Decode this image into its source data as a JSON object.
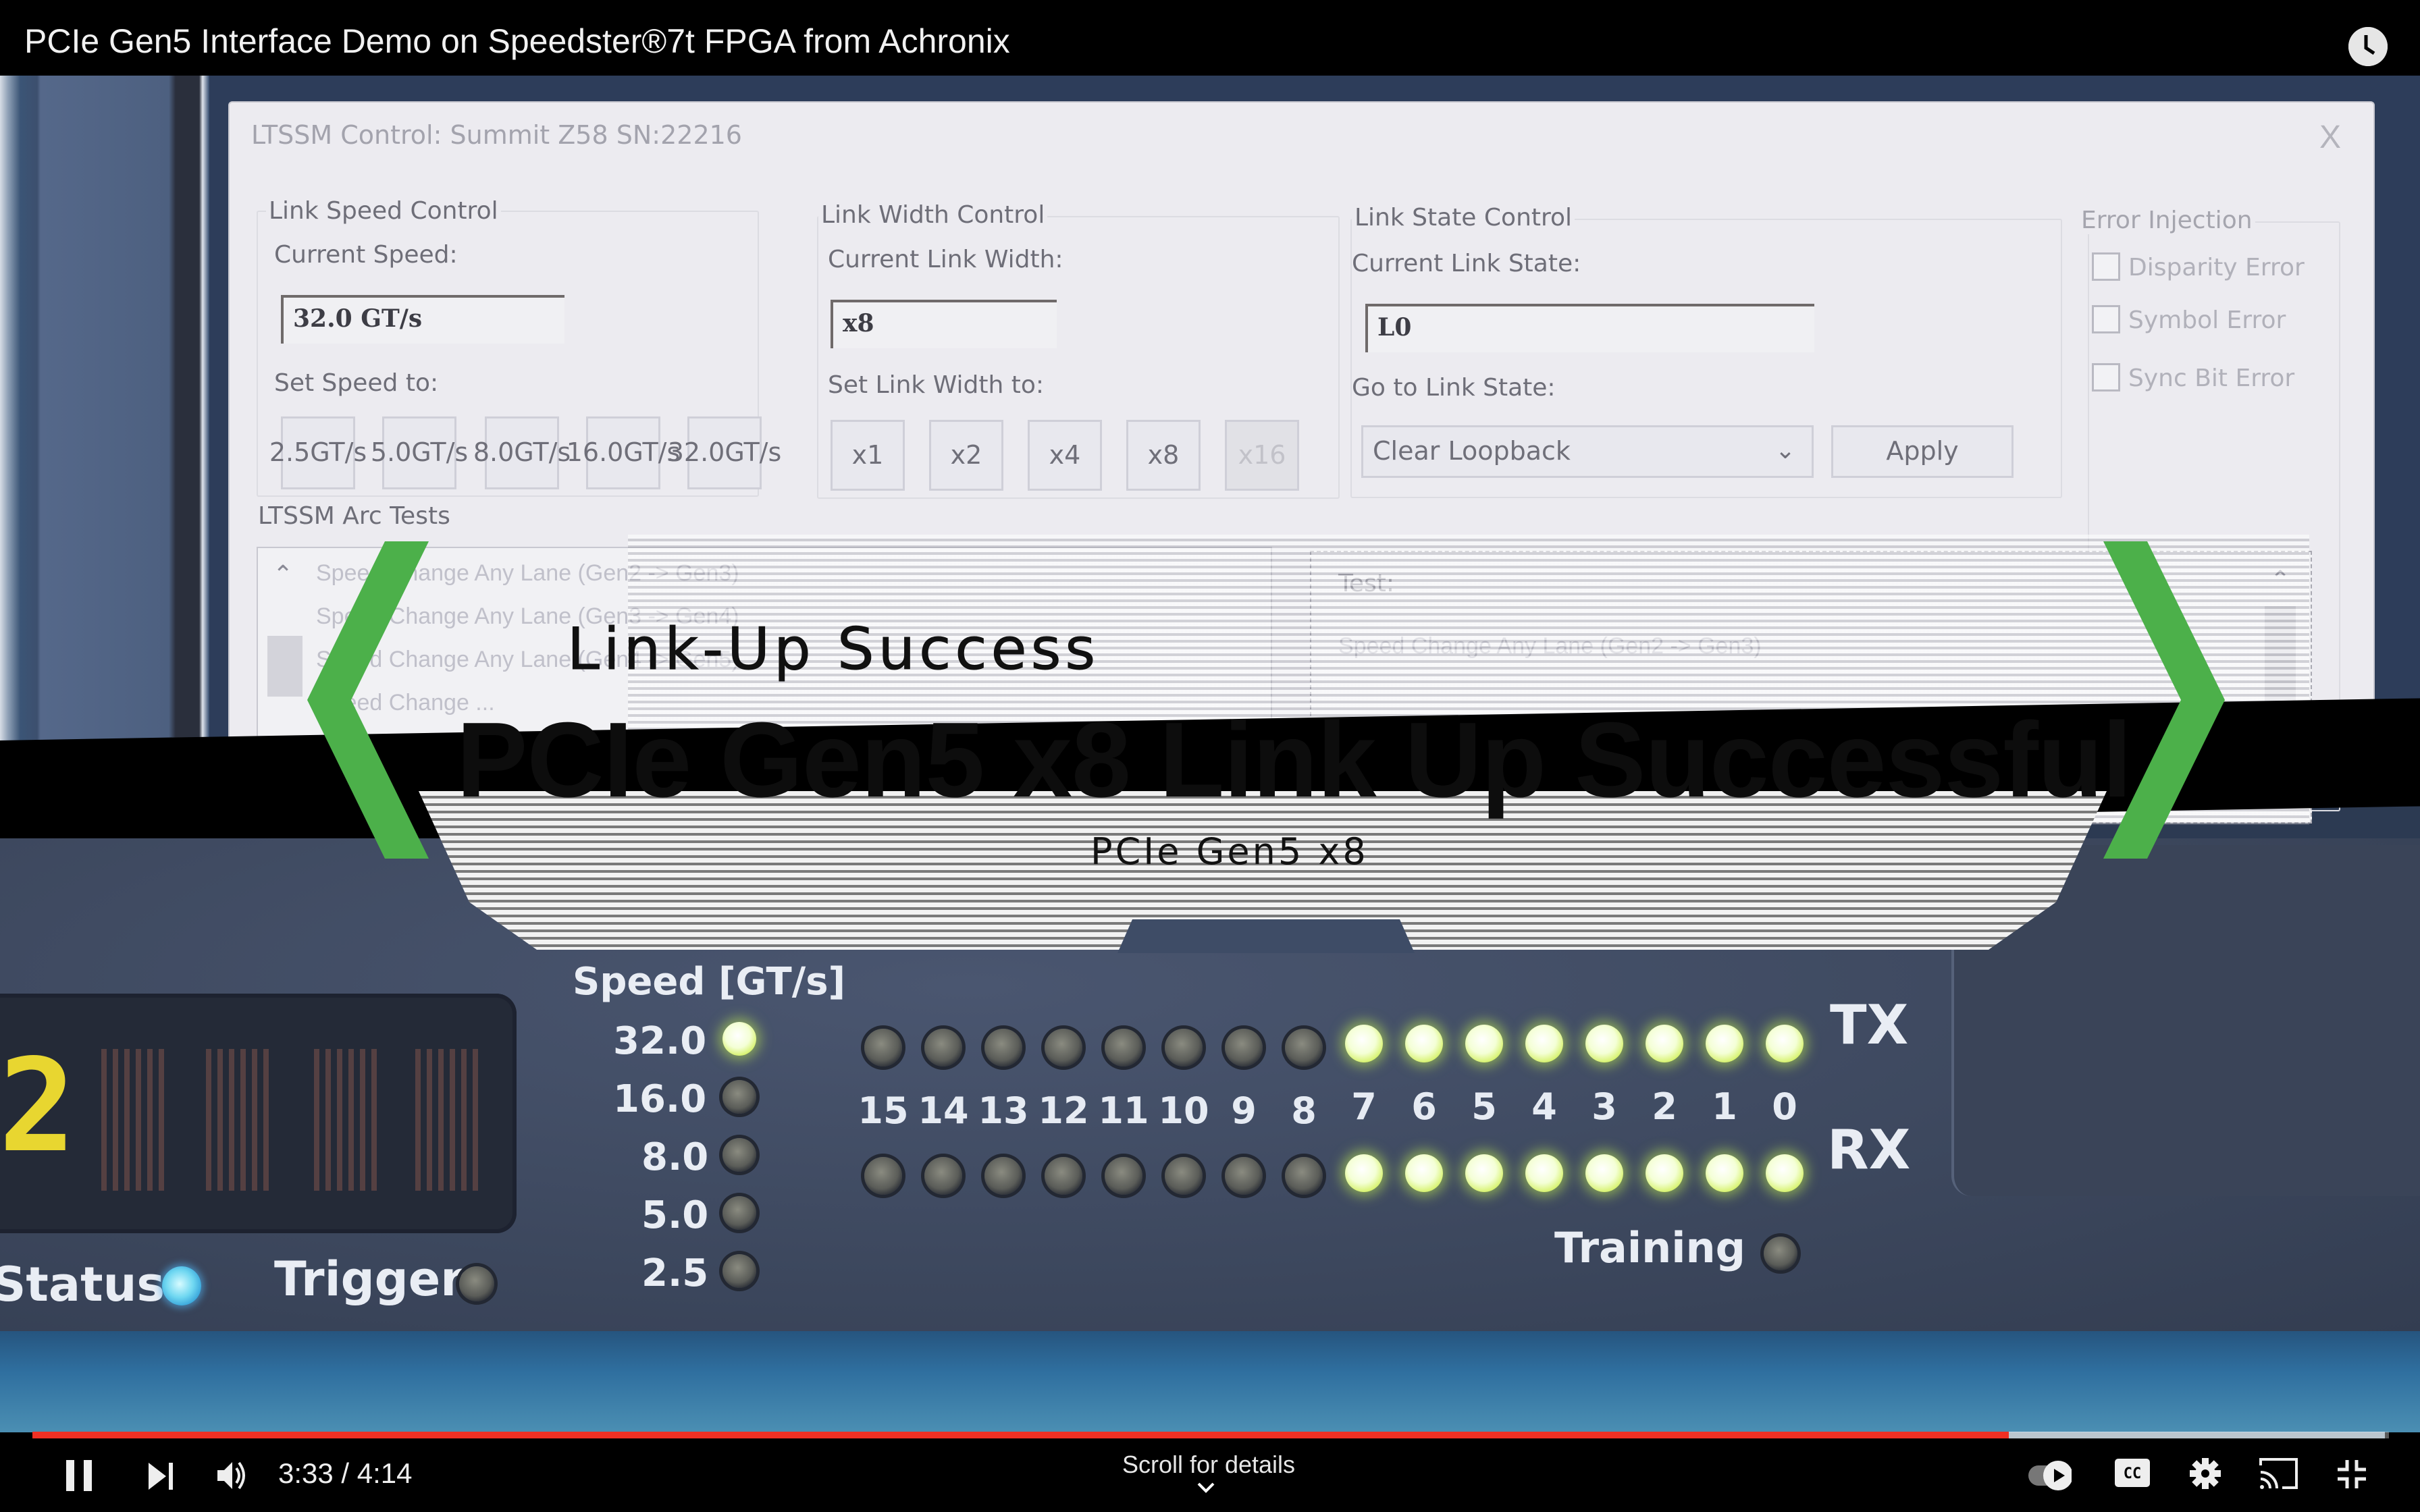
{
  "player": {
    "title": "PCIe Gen5 Interface Demo on Speedster®7t FPGA from Achronix",
    "watch_later_icon": "clock-icon",
    "time_current": "3:33",
    "time_total": "4:14",
    "time_display": "3:33 / 4:14",
    "progress_played_fraction": 0.8386,
    "progress_buffered_fraction": 0.9984,
    "scroll_hint": "Scroll for details",
    "controls": {
      "play_pause_icon": "pause-icon",
      "next_icon": "next-icon",
      "volume_icon": "volume-icon",
      "autoplay_icon": "autoplay-toggle-icon",
      "captions_icon": "cc-icon",
      "captions_label": "CC",
      "settings_icon": "gear-icon",
      "cast_icon": "cast-icon",
      "fullscreen_icon": "exit-fullscreen-icon"
    },
    "colors": {
      "progress": "#f03024",
      "banner_chevron": "#4cb04a",
      "led_on": "#d6f26b"
    }
  },
  "dialog": {
    "title": "LTSSM Control: Summit Z58 SN:22216",
    "close_label": "X",
    "link_speed": {
      "group_label": "Link Speed Control",
      "current_label": "Current Speed:",
      "current_value": "32.0 GT/s",
      "set_label": "Set Speed to:",
      "buttons": [
        {
          "line1": "2.5",
          "line2": "GT/s"
        },
        {
          "line1": "5.0",
          "line2": "GT/s"
        },
        {
          "line1": "8.0",
          "line2": "GT/s"
        },
        {
          "line1": "16.0",
          "line2": "GT/s"
        },
        {
          "line1": "32.0",
          "line2": "GT/s"
        }
      ]
    },
    "link_width": {
      "group_label": "Link Width Control",
      "current_label": "Current Link Width:",
      "current_value": "x8",
      "set_label": "Set Link Width to:",
      "buttons": [
        "x1",
        "x2",
        "x4",
        "x8",
        "x16"
      ],
      "disabled": [
        "x16"
      ]
    },
    "link_state": {
      "group_label": "Link State Control",
      "current_label": "Current Link State:",
      "current_value": "L0",
      "goto_label": "Go to Link State:",
      "select_value": "Clear Loopback",
      "apply_label": "Apply"
    },
    "error_injection": {
      "group_label": "Error Injection",
      "options": [
        {
          "label": "Disparity Error",
          "checked": false
        },
        {
          "label": "Symbol Error",
          "checked": false
        },
        {
          "label": "Sync Bit Error",
          "checked": false
        }
      ]
    },
    "arc_tests": {
      "group_label": "LTSSM Arc Tests",
      "items": [
        "Speed Change Any Lane (Gen2 -> Gen3)",
        "Speed Change Any Lane (Gen3 -> Gen4)",
        "Speed Change Any Lane (Gen4 -> Gen5)",
        "Speed Change ..."
      ],
      "detail_label": "Test:",
      "detail_value": "Speed Change Any Lane (Gen2 -> Gen3)"
    }
  },
  "banner": {
    "subtitle": "Link-Up Success",
    "headline": "PCIe Gen5 x8 Link Up Successful",
    "caption": "PCIe Gen5 x8"
  },
  "device": {
    "display_digit": "2",
    "speed_label": "Speed [GT/s]",
    "speeds": [
      {
        "label": "32.0",
        "on": true
      },
      {
        "label": "16.0",
        "on": false
      },
      {
        "label": "8.0",
        "on": false
      },
      {
        "label": "5.0",
        "on": false
      },
      {
        "label": "2.5",
        "on": false
      }
    ],
    "lanes": [
      "15",
      "14",
      "13",
      "12",
      "11",
      "10",
      "9",
      "8",
      "7",
      "6",
      "5",
      "4",
      "3",
      "2",
      "1",
      "0"
    ],
    "tx_label": "TX",
    "rx_label": "RX",
    "tx_on": [
      false,
      false,
      false,
      false,
      false,
      false,
      false,
      false,
      true,
      true,
      true,
      true,
      true,
      true,
      true,
      true
    ],
    "rx_on": [
      false,
      false,
      false,
      false,
      false,
      false,
      false,
      false,
      true,
      true,
      true,
      true,
      true,
      true,
      true,
      true
    ],
    "status_label": "Status",
    "trigger_label": "Trigger",
    "training_label": "Training",
    "training_on": false
  }
}
